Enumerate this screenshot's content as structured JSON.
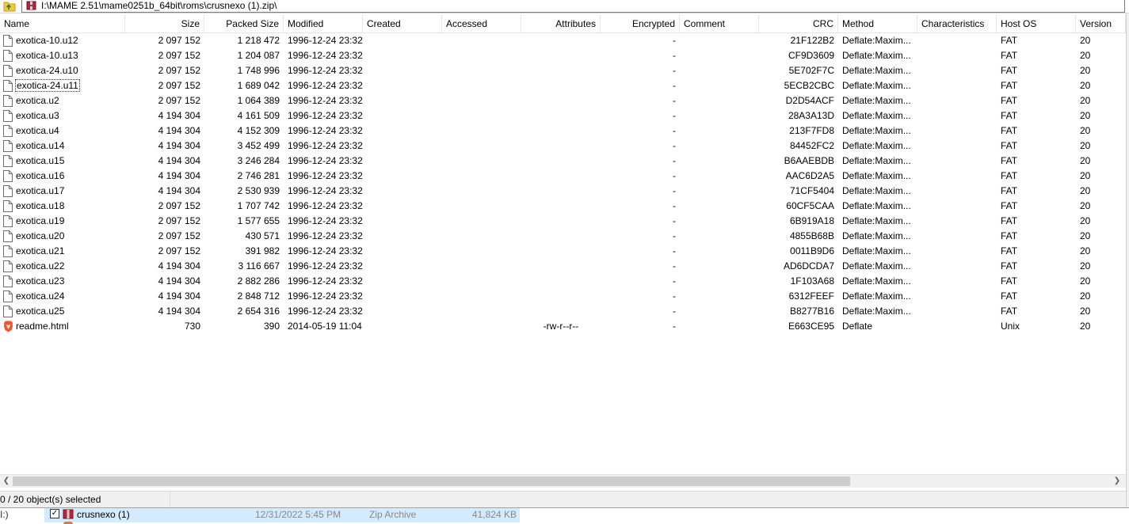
{
  "address": {
    "path": "I:\\MAME 2.51\\mame0251b_64bit\\roms\\crusnexo (1).zip\\"
  },
  "columns": [
    {
      "label": "Name",
      "align": "l"
    },
    {
      "label": "Size",
      "align": "r"
    },
    {
      "label": "Packed Size",
      "align": "r"
    },
    {
      "label": "Modified",
      "align": "l"
    },
    {
      "label": "Created",
      "align": "l"
    },
    {
      "label": "Accessed",
      "align": "l"
    },
    {
      "label": "Attributes",
      "align": "r"
    },
    {
      "label": "Encrypted",
      "align": "r"
    },
    {
      "label": "Comment",
      "align": "l"
    },
    {
      "label": "CRC",
      "align": "r"
    },
    {
      "label": "Method",
      "align": "l"
    },
    {
      "label": "Characteristics",
      "align": "l"
    },
    {
      "label": "Host OS",
      "align": "l"
    },
    {
      "label": "Version",
      "align": "l"
    }
  ],
  "files": [
    {
      "name": "exotica-10.u12",
      "size": "2 097 152",
      "packed": "1 218 472",
      "modified": "1996-12-24 23:32",
      "created": "",
      "accessed": "",
      "attributes": "",
      "encrypted": "-",
      "comment": "",
      "crc": "21F122B2",
      "method": "Deflate:Maxim...",
      "characteristics": "",
      "hostos": "FAT",
      "version": "20",
      "icon": "file-icon"
    },
    {
      "name": "exotica-10.u13",
      "size": "2 097 152",
      "packed": "1 204 087",
      "modified": "1996-12-24 23:32",
      "created": "",
      "accessed": "",
      "attributes": "",
      "encrypted": "-",
      "comment": "",
      "crc": "CF9D3609",
      "method": "Deflate:Maxim...",
      "characteristics": "",
      "hostos": "FAT",
      "version": "20",
      "icon": "file-icon"
    },
    {
      "name": "exotica-24.u10",
      "size": "2 097 152",
      "packed": "1 748 996",
      "modified": "1996-12-24 23:32",
      "created": "",
      "accessed": "",
      "attributes": "",
      "encrypted": "-",
      "comment": "",
      "crc": "5E702F7C",
      "method": "Deflate:Maxim...",
      "characteristics": "",
      "hostos": "FAT",
      "version": "20",
      "icon": "file-icon"
    },
    {
      "name": "exotica-24.u11",
      "size": "2 097 152",
      "packed": "1 689 042",
      "modified": "1996-12-24 23:32",
      "created": "",
      "accessed": "",
      "attributes": "",
      "encrypted": "-",
      "comment": "",
      "crc": "5ECB2CBC",
      "method": "Deflate:Maxim...",
      "characteristics": "",
      "hostos": "FAT",
      "version": "20",
      "icon": "file-icon",
      "focus": true
    },
    {
      "name": "exotica.u2",
      "size": "2 097 152",
      "packed": "1 064 389",
      "modified": "1996-12-24 23:32",
      "created": "",
      "accessed": "",
      "attributes": "",
      "encrypted": "-",
      "comment": "",
      "crc": "D2D54ACF",
      "method": "Deflate:Maxim...",
      "characteristics": "",
      "hostos": "FAT",
      "version": "20",
      "icon": "file-icon"
    },
    {
      "name": "exotica.u3",
      "size": "4 194 304",
      "packed": "4 161 509",
      "modified": "1996-12-24 23:32",
      "created": "",
      "accessed": "",
      "attributes": "",
      "encrypted": "-",
      "comment": "",
      "crc": "28A3A13D",
      "method": "Deflate:Maxim...",
      "characteristics": "",
      "hostos": "FAT",
      "version": "20",
      "icon": "file-icon"
    },
    {
      "name": "exotica.u4",
      "size": "4 194 304",
      "packed": "4 152 309",
      "modified": "1996-12-24 23:32",
      "created": "",
      "accessed": "",
      "attributes": "",
      "encrypted": "-",
      "comment": "",
      "crc": "213F7FD8",
      "method": "Deflate:Maxim...",
      "characteristics": "",
      "hostos": "FAT",
      "version": "20",
      "icon": "file-icon"
    },
    {
      "name": "exotica.u14",
      "size": "4 194 304",
      "packed": "3 452 499",
      "modified": "1996-12-24 23:32",
      "created": "",
      "accessed": "",
      "attributes": "",
      "encrypted": "-",
      "comment": "",
      "crc": "84452FC2",
      "method": "Deflate:Maxim...",
      "characteristics": "",
      "hostos": "FAT",
      "version": "20",
      "icon": "file-icon"
    },
    {
      "name": "exotica.u15",
      "size": "4 194 304",
      "packed": "3 246 284",
      "modified": "1996-12-24 23:32",
      "created": "",
      "accessed": "",
      "attributes": "",
      "encrypted": "-",
      "comment": "",
      "crc": "B6AAEBDB",
      "method": "Deflate:Maxim...",
      "characteristics": "",
      "hostos": "FAT",
      "version": "20",
      "icon": "file-icon"
    },
    {
      "name": "exotica.u16",
      "size": "4 194 304",
      "packed": "2 746 281",
      "modified": "1996-12-24 23:32",
      "created": "",
      "accessed": "",
      "attributes": "",
      "encrypted": "-",
      "comment": "",
      "crc": "AAC6D2A5",
      "method": "Deflate:Maxim...",
      "characteristics": "",
      "hostos": "FAT",
      "version": "20",
      "icon": "file-icon"
    },
    {
      "name": "exotica.u17",
      "size": "4 194 304",
      "packed": "2 530 939",
      "modified": "1996-12-24 23:32",
      "created": "",
      "accessed": "",
      "attributes": "",
      "encrypted": "-",
      "comment": "",
      "crc": "71CF5404",
      "method": "Deflate:Maxim...",
      "characteristics": "",
      "hostos": "FAT",
      "version": "20",
      "icon": "file-icon"
    },
    {
      "name": "exotica.u18",
      "size": "2 097 152",
      "packed": "1 707 742",
      "modified": "1996-12-24 23:32",
      "created": "",
      "accessed": "",
      "attributes": "",
      "encrypted": "-",
      "comment": "",
      "crc": "60CF5CAA",
      "method": "Deflate:Maxim...",
      "characteristics": "",
      "hostos": "FAT",
      "version": "20",
      "icon": "file-icon"
    },
    {
      "name": "exotica.u19",
      "size": "2 097 152",
      "packed": "1 577 655",
      "modified": "1996-12-24 23:32",
      "created": "",
      "accessed": "",
      "attributes": "",
      "encrypted": "-",
      "comment": "",
      "crc": "6B919A18",
      "method": "Deflate:Maxim...",
      "characteristics": "",
      "hostos": "FAT",
      "version": "20",
      "icon": "file-icon"
    },
    {
      "name": "exotica.u20",
      "size": "2 097 152",
      "packed": "430 571",
      "modified": "1996-12-24 23:32",
      "created": "",
      "accessed": "",
      "attributes": "",
      "encrypted": "-",
      "comment": "",
      "crc": "4855B68B",
      "method": "Deflate:Maxim...",
      "characteristics": "",
      "hostos": "FAT",
      "version": "20",
      "icon": "file-icon"
    },
    {
      "name": "exotica.u21",
      "size": "2 097 152",
      "packed": "391 982",
      "modified": "1996-12-24 23:32",
      "created": "",
      "accessed": "",
      "attributes": "",
      "encrypted": "-",
      "comment": "",
      "crc": "0011B9D6",
      "method": "Deflate:Maxim...",
      "characteristics": "",
      "hostos": "FAT",
      "version": "20",
      "icon": "file-icon"
    },
    {
      "name": "exotica.u22",
      "size": "4 194 304",
      "packed": "3 116 667",
      "modified": "1996-12-24 23:32",
      "created": "",
      "accessed": "",
      "attributes": "",
      "encrypted": "-",
      "comment": "",
      "crc": "AD6DCDA7",
      "method": "Deflate:Maxim...",
      "characteristics": "",
      "hostos": "FAT",
      "version": "20",
      "icon": "file-icon"
    },
    {
      "name": "exotica.u23",
      "size": "4 194 304",
      "packed": "2 882 286",
      "modified": "1996-12-24 23:32",
      "created": "",
      "accessed": "",
      "attributes": "",
      "encrypted": "-",
      "comment": "",
      "crc": "1F103A68",
      "method": "Deflate:Maxim...",
      "characteristics": "",
      "hostos": "FAT",
      "version": "20",
      "icon": "file-icon"
    },
    {
      "name": "exotica.u24",
      "size": "4 194 304",
      "packed": "2 848 712",
      "modified": "1996-12-24 23:32",
      "created": "",
      "accessed": "",
      "attributes": "",
      "encrypted": "-",
      "comment": "",
      "crc": "6312FEEF",
      "method": "Deflate:Maxim...",
      "characteristics": "",
      "hostos": "FAT",
      "version": "20",
      "icon": "file-icon"
    },
    {
      "name": "exotica.u25",
      "size": "4 194 304",
      "packed": "2 654 316",
      "modified": "1996-12-24 23:32",
      "created": "",
      "accessed": "",
      "attributes": "",
      "encrypted": "-",
      "comment": "",
      "crc": "B8277B16",
      "method": "Deflate:Maxim...",
      "characteristics": "",
      "hostos": "FAT",
      "version": "20",
      "icon": "file-icon"
    },
    {
      "name": "readme.html",
      "size": "730",
      "packed": "390",
      "modified": "2014-05-19 11:04",
      "created": "",
      "accessed": "",
      "attributes": "-rw-r--r--",
      "encrypted": "-",
      "comment": "",
      "crc": "E663CE95",
      "method": "Deflate",
      "characteristics": "",
      "hostos": "Unix",
      "version": "20",
      "icon": "brave-html-icon"
    }
  ],
  "status": {
    "selection": "0 / 20 object(s) selected"
  },
  "behind": {
    "name": "crusnexo (1)",
    "date": "12/31/2022 5:45 PM",
    "type": "Zip Archive",
    "size": "41,824 KB",
    "drive": "I:)"
  },
  "colors": {
    "accent": "#cce8ff",
    "brave": "#fb542b"
  }
}
